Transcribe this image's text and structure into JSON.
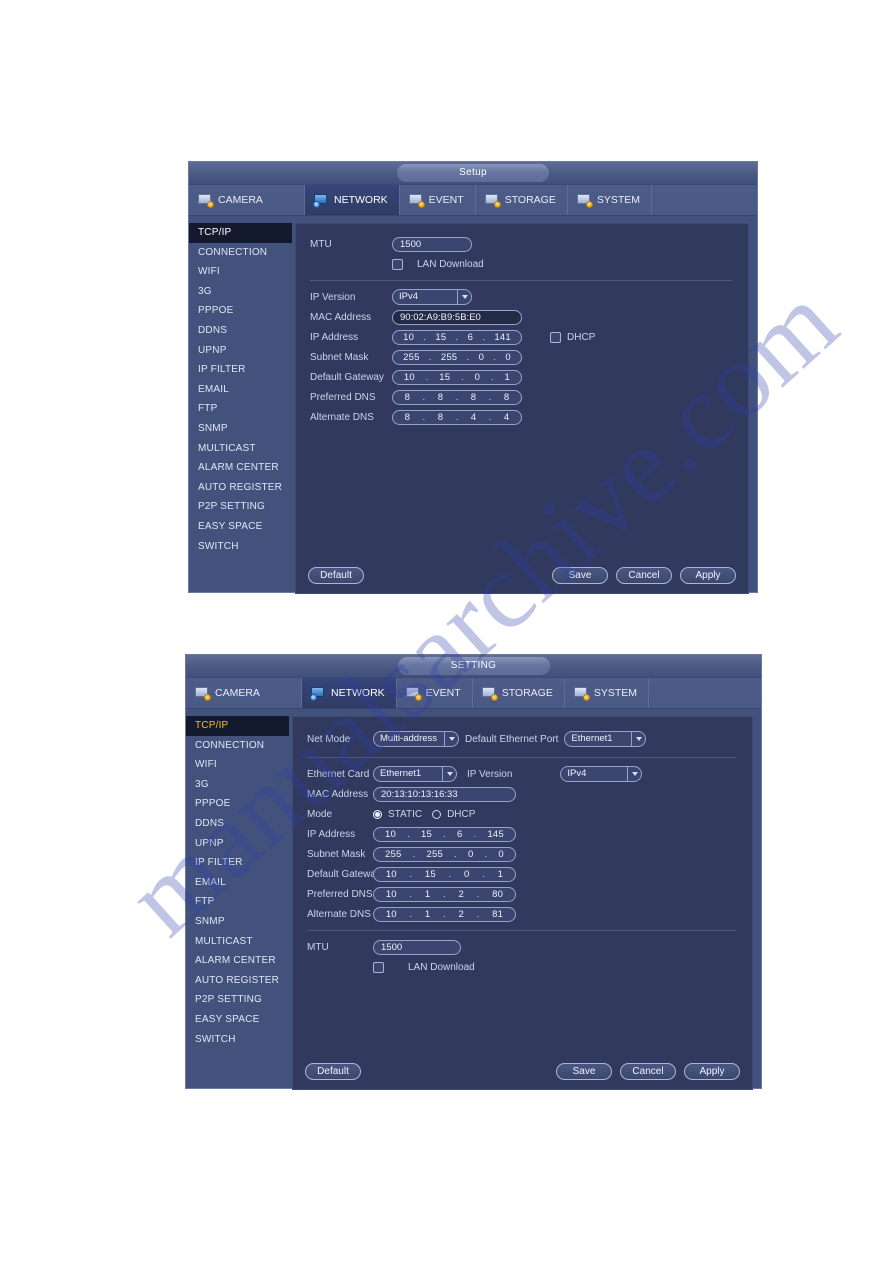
{
  "watermark": {
    "text": "manualsarchive.com"
  },
  "dialog1": {
    "title": "Setup",
    "tabs": [
      {
        "label": "CAMERA",
        "icon": "camera-icon",
        "active": false
      },
      {
        "label": "NETWORK",
        "icon": "network-icon",
        "active": true
      },
      {
        "label": "EVENT",
        "icon": "event-icon",
        "active": false
      },
      {
        "label": "STORAGE",
        "icon": "storage-icon",
        "active": false
      },
      {
        "label": "SYSTEM",
        "icon": "system-icon",
        "active": false
      }
    ],
    "sidebar": [
      "TCP/IP",
      "CONNECTION",
      "WIFI",
      "3G",
      "PPPOE",
      "DDNS",
      "UPNP",
      "IP FILTER",
      "EMAIL",
      "FTP",
      "SNMP",
      "MULTICAST",
      "ALARM CENTER",
      "AUTO REGISTER",
      "P2P SETTING",
      "EASY SPACE",
      "SWITCH"
    ],
    "selected_sidebar": "TCP/IP",
    "form": {
      "mtu_label": "MTU",
      "mtu_value": "1500",
      "lan_download_label": "LAN Download",
      "lan_download_checked": false,
      "ip_version_label": "IP Version",
      "ip_version_value": "IPv4",
      "mac_label": "MAC Address",
      "mac_value": "90:02:A9:B9:5B:E0",
      "ip_address_label": "IP Address",
      "ip_address": [
        "10",
        "15",
        "6",
        "141"
      ],
      "subnet_label": "Subnet Mask",
      "subnet": [
        "255",
        "255",
        "0",
        "0"
      ],
      "gateway_label": "Default Gateway",
      "gateway": [
        "10",
        "15",
        "0",
        "1"
      ],
      "preferred_dns_label": "Preferred DNS",
      "preferred_dns": [
        "8",
        "8",
        "8",
        "8"
      ],
      "alternate_dns_label": "Alternate DNS",
      "alternate_dns": [
        "8",
        "8",
        "4",
        "4"
      ],
      "dhcp_label": "DHCP",
      "dhcp_checked": false
    },
    "buttons": {
      "default": "Default",
      "save": "Save",
      "cancel": "Cancel",
      "apply": "Apply"
    }
  },
  "dialog2": {
    "title": "SETTING",
    "tabs": [
      {
        "label": "CAMERA",
        "icon": "camera-icon",
        "active": false
      },
      {
        "label": "NETWORK",
        "icon": "network-icon",
        "active": true
      },
      {
        "label": "EVENT",
        "icon": "event-icon",
        "active": false
      },
      {
        "label": "STORAGE",
        "icon": "storage-icon",
        "active": false
      },
      {
        "label": "SYSTEM",
        "icon": "system-icon",
        "active": false
      }
    ],
    "sidebar": [
      "TCP/IP",
      "CONNECTION",
      "WIFI",
      "3G",
      "PPPOE",
      "DDNS",
      "UPNP",
      "IP FILTER",
      "EMAIL",
      "FTP",
      "SNMP",
      "MULTICAST",
      "ALARM CENTER",
      "AUTO REGISTER",
      "P2P SETTING",
      "EASY SPACE",
      "SWITCH"
    ],
    "selected_sidebar": "TCP/IP",
    "form": {
      "net_mode_label": "Net Mode",
      "net_mode_value": "Multi-address",
      "default_eth_port_label": "Default Ethernet Port",
      "default_eth_port_value": "Ethernet1",
      "ethernet_card_label": "Ethernet Card",
      "ethernet_card_value": "Ethernet1",
      "ip_version_label": "IP Version",
      "ip_version_value": "IPv4",
      "mac_label": "MAC Address",
      "mac_value": "20:13:10:13:16:33",
      "mode_label": "Mode",
      "mode_static_label": "STATIC",
      "mode_dhcp_label": "DHCP",
      "mode_selected": "STATIC",
      "ip_address_label": "IP Address",
      "ip_address": [
        "10",
        "15",
        "6",
        "145"
      ],
      "subnet_label": "Subnet Mask",
      "subnet": [
        "255",
        "255",
        "0",
        "0"
      ],
      "gateway_label": "Default Gateway",
      "gateway": [
        "10",
        "15",
        "0",
        "1"
      ],
      "preferred_dns_label": "Preferred DNS",
      "preferred_dns": [
        "10",
        "1",
        "2",
        "80"
      ],
      "alternate_dns_label": "Alternate DNS",
      "alternate_dns": [
        "10",
        "1",
        "2",
        "81"
      ],
      "mtu_label": "MTU",
      "mtu_value": "1500",
      "lan_download_label": "LAN Download",
      "lan_download_checked": false
    },
    "buttons": {
      "default": "Default",
      "save": "Save",
      "cancel": "Cancel",
      "apply": "Apply"
    }
  }
}
